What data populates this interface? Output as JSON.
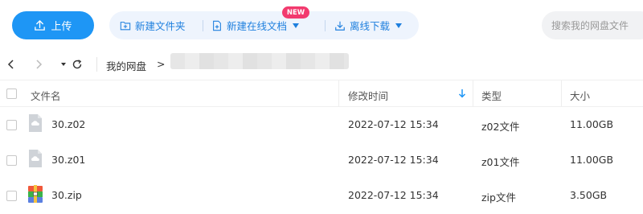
{
  "toolbar": {
    "upload_label": "上传",
    "new_folder_label": "新建文件夹",
    "new_doc_label": "新建在线文档",
    "new_badge": "NEW",
    "offline_download_label": "离线下载",
    "search_placeholder": "搜索我的网盘文件"
  },
  "breadcrumb": {
    "root": "我的网盘",
    "separator": ">"
  },
  "table": {
    "headers": {
      "name": "文件名",
      "modified": "修改时间",
      "type": "类型",
      "size": "大小"
    },
    "sort_indicator": "down-arrow-icon",
    "rows": [
      {
        "name": "30.z02",
        "modified": "2022-07-12 15:34",
        "type": "z02文件",
        "size": "11.00GB",
        "icon": "cloud-file-icon"
      },
      {
        "name": "30.z01",
        "modified": "2022-07-12 15:34",
        "type": "z01文件",
        "size": "11.00GB",
        "icon": "cloud-file-icon"
      },
      {
        "name": "30.zip",
        "modified": "2022-07-12 15:34",
        "type": "zip文件",
        "size": "3.50GB",
        "icon": "zip-archive-icon"
      }
    ]
  },
  "colors": {
    "accent": "#1e96f5",
    "action_text": "#1e7fde",
    "action_bg": "#eef4fd",
    "badge": "#f23a6e"
  }
}
